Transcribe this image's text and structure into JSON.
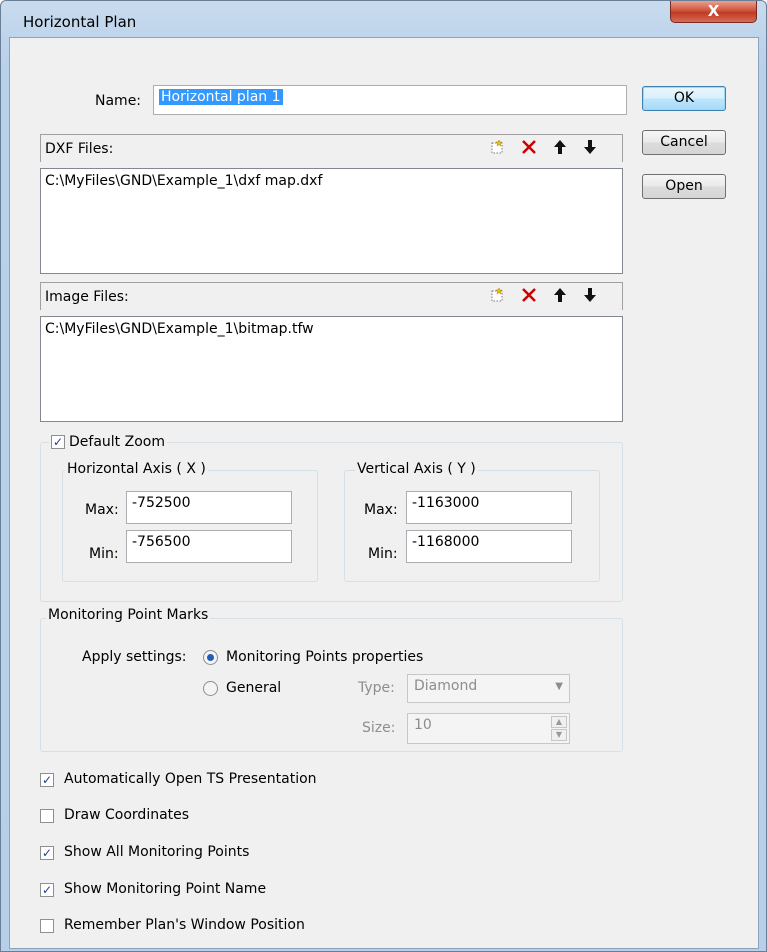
{
  "window": {
    "title": "Horizontal Plan",
    "close_label": "X"
  },
  "name_field": {
    "label": "Name:",
    "value": "Horizontal plan 1"
  },
  "buttons": {
    "ok": "OK",
    "cancel": "Cancel",
    "open": "Open"
  },
  "dxf": {
    "header": "DXF Files:",
    "items": [
      "C:\\MyFiles\\GND\\Example_1\\dxf map.dxf"
    ]
  },
  "images": {
    "header": "Image Files:",
    "items": [
      "C:\\MyFiles\\GND\\Example_1\\bitmap.tfw"
    ]
  },
  "list_toolbar": {
    "new": "new-file-icon",
    "delete": "delete-x-icon",
    "up": "move-up-arrow-icon",
    "down": "move-down-arrow-icon"
  },
  "default_zoom": {
    "label": "Default Zoom",
    "checked": true,
    "horizontal": {
      "title": "Horizontal Axis ( X )",
      "max_label": "Max:",
      "max": "-752500",
      "min_label": "Min:",
      "min": "-756500"
    },
    "vertical": {
      "title": "Vertical Axis ( Y )",
      "max_label": "Max:",
      "max": "-1163000",
      "min_label": "Min:",
      "min": "-1168000"
    }
  },
  "marks": {
    "title": "Monitoring Point Marks",
    "apply_label": "Apply settings:",
    "opt_props": "Monitoring Points properties",
    "opt_general": "General",
    "selected": "Monitoring Points properties",
    "type_label": "Type:",
    "type_value": "Diamond",
    "size_label": "Size:",
    "size_value": "10"
  },
  "options": [
    {
      "label": "Automatically Open TS Presentation",
      "checked": true
    },
    {
      "label": "Draw Coordinates",
      "checked": false
    },
    {
      "label": "Show All Monitoring Points",
      "checked": true
    },
    {
      "label": "Show Monitoring Point Name",
      "checked": true
    },
    {
      "label": "Remember Plan's Window Position",
      "checked": false
    }
  ],
  "colors": {
    "selection": "#3399ff",
    "close": "#c7432b",
    "delete": "#cc0000"
  }
}
